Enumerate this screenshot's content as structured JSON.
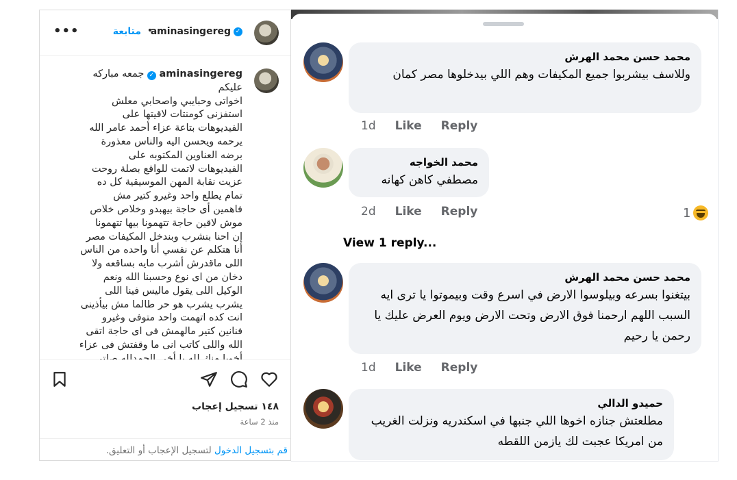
{
  "instagram": {
    "username": "aminasingereg",
    "follow_label": "متابعة",
    "separator": "•",
    "more_label": "•••",
    "caption": "جمعه مباركه عليكم\nاخواتى وحبايبي واصحابي معلش\nاستفزنى كومنتات لاقيتها على\nالفيديوهات بتاعة عزاء أحمد عامر الله\nيرحمه ويحسن اليه والناس معذورة\nبرضه العناوين المكتوبه على\nالفيديوهات لاتمت للواقع بصلة روحت\nعزيت نقابة المهن الموسيقية كل ده\nتمام يطلع واحد وغيرو كتير مش\nفاهمين أى حاجة بيهبدو وخلاص خلاص\nموش لاقين حاجة تتهمونا بيها تتهمونا\nإن احنا بنشرب وبندخل المكيفات مصر\nأنا هتكلم عن نفسي أنا واحده من الناس\nاللى ماقدرش أشرب مايه بساقعه ولا\nدخان من اى نوع وحسبنا الله ونعم\nالوكيل اللى يقول ماليس فينا اللى\nيشرب يشرب هو حر طالما مش بيأذينى\nانت كده اتهمت واحد متوفى وغيرو\nفنانين كتير مالهمش فى اى حاجة اتقى\nالله واللى كاتب انى ما وقفتش فى عزاء\nأخويا منك لله يا أخى الحمدلله صلتى\nكاملة بدون ترتيب الناس اللى أبهوا ش",
    "likes": "١٤٨ تسجيل إعجاب",
    "time": "منذ 2 ساعة",
    "login_link": "قم بتسجيل الدخول",
    "login_rest": " لتسجيل الإعجاب أو التعليق."
  },
  "facebook": {
    "comments": [
      {
        "name": "محمد حسن محمد الهرش",
        "text": "وللاسف بيشربوا جميع المكيفات وهم اللي بيدخلوها مصر كمان",
        "time": "1d",
        "like": "Like",
        "reply": "Reply"
      },
      {
        "name": "محمد الخواجه",
        "text": "مصطفي كاهن كهانه",
        "time": "2d",
        "like": "Like",
        "reply": "Reply",
        "reaction_count": "1",
        "view_replies": "View 1 reply..."
      },
      {
        "name": "محمد حسن محمد الهرش",
        "text": "بيتغنوا بسرعه وبيلوسوا الارض في اسرع وقت وبيموتوا يا ترى ايه السبب اللهم ارحمنا فوق الارض وتحت الارض ويوم العرض عليك يا رحمن يا رحيم",
        "time": "1d",
        "like": "Like",
        "reply": "Reply"
      },
      {
        "name": "حميدو الدالي",
        "text": "مطلعتش جنازه اخوها اللي جنبها في اسكندريه ونزلت الغريب من امريكا عجبت لك يازمن اللقطه"
      }
    ]
  }
}
